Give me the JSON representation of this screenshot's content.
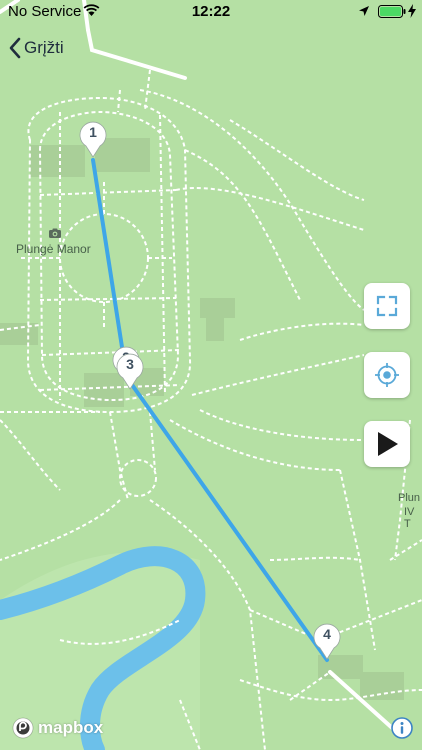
{
  "status_bar": {
    "carrier": "No Service",
    "time": "12:22"
  },
  "nav": {
    "back_label": "Grįžti"
  },
  "map": {
    "place_label": "Plungė Manor",
    "edge_label_1": "Plun",
    "edge_label_2": "IV T",
    "route_color": "#3ea6e8",
    "water_color": "#6cc0ea",
    "park_color": "#b5e0a4",
    "pins": [
      {
        "label": "1"
      },
      {
        "label": "2"
      },
      {
        "label": "3"
      },
      {
        "label": "4"
      }
    ]
  },
  "controls": {
    "fullscreen": "fullscreen-icon",
    "locate": "locate-icon",
    "play": "play-icon"
  },
  "attribution": {
    "logo_text": "mapbox"
  }
}
